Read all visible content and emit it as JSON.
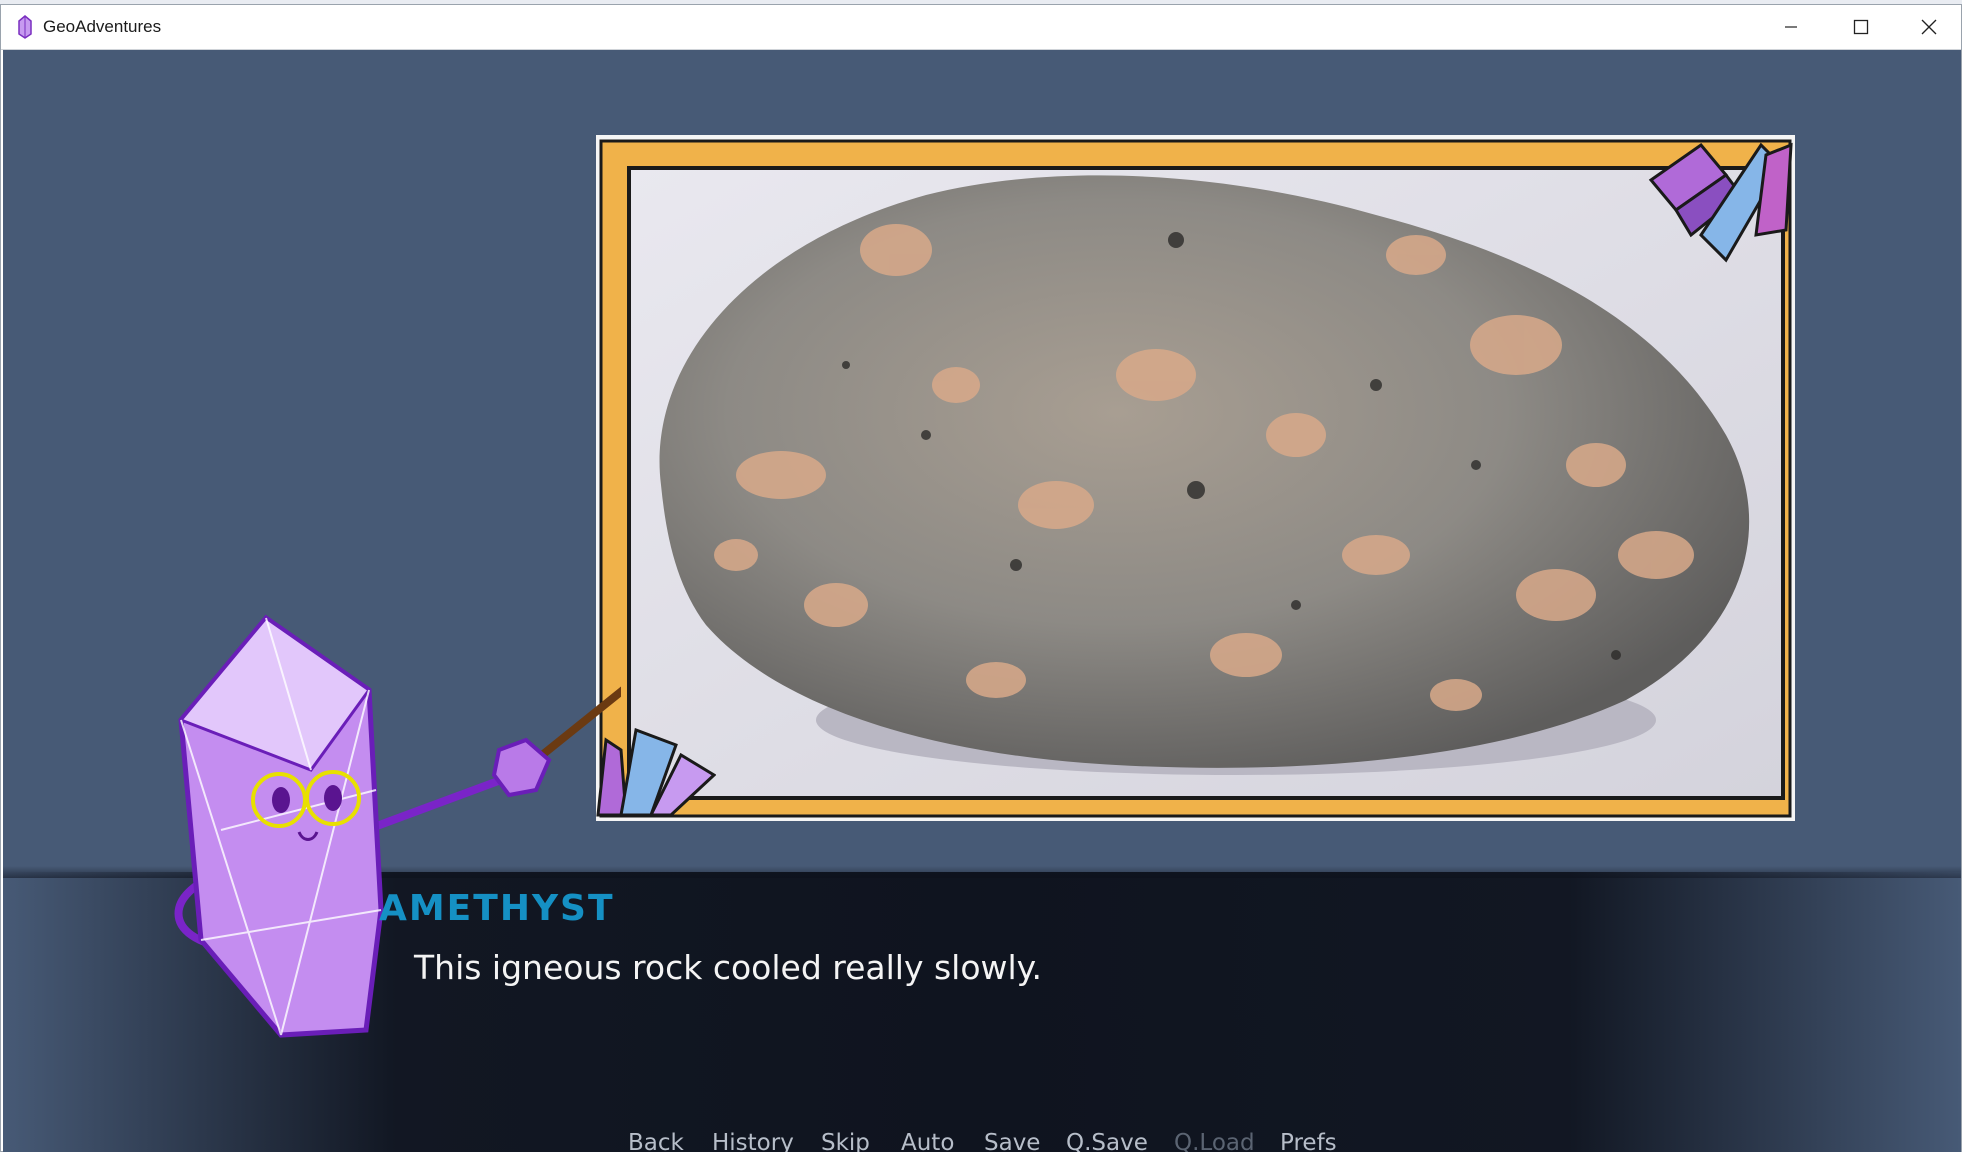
{
  "window": {
    "title": "GeoAdventures",
    "icon": "amethyst-crystal-icon",
    "controls": [
      "minimize-icon",
      "maximize-icon",
      "close-icon"
    ]
  },
  "scene": {
    "background_color": "#475a76",
    "frame_color": "#f0b24a",
    "picture": "igneous-rock-photo",
    "pointer": "pointer-stick"
  },
  "character": {
    "name_icon": "amethyst-character"
  },
  "dialogue": {
    "speaker": "AMETHYST",
    "speaker_color": "#1590c4",
    "text": "This igneous rock cooled really slowly."
  },
  "quick_menu": {
    "items": [
      {
        "label": "Back"
      },
      {
        "label": "History"
      },
      {
        "label": "Skip"
      },
      {
        "label": "Auto"
      },
      {
        "label": "Save"
      },
      {
        "label": "Q.Save"
      },
      {
        "label": "Q.Load",
        "disabled": true
      },
      {
        "label": "Prefs"
      }
    ]
  }
}
